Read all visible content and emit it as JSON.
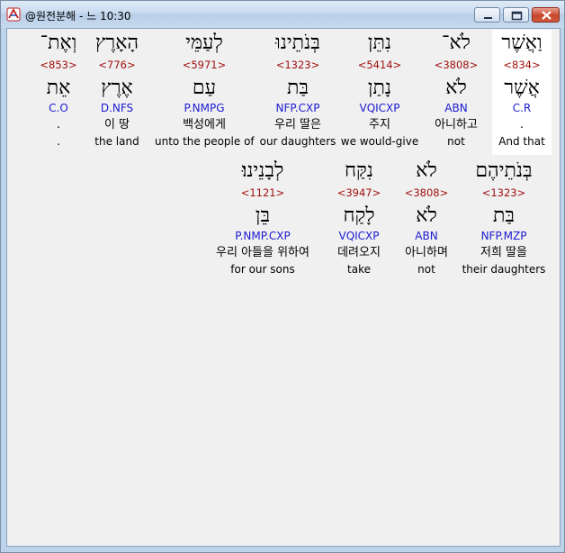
{
  "window": {
    "title": "@원전분해 - 느 10:30"
  },
  "rows": [
    [
      {
        "hebrew": "וַאֲשֶׁר",
        "strong": "<834>",
        "lemma": "אֲשֶׁר",
        "morph": "C.R",
        "korean": ".",
        "english": "And that"
      },
      {
        "hebrew": "לֹא־",
        "strong": "<3808>",
        "lemma": "לֹא",
        "morph": "ABN",
        "korean": "아니하고",
        "english": "not"
      },
      {
        "hebrew": "נִתֵּן",
        "strong": "<5414>",
        "lemma": "נָתַן",
        "morph": "VQICXP",
        "korean": "주지",
        "english": "we would-give"
      },
      {
        "hebrew": "בְּנֹתֵינוּ",
        "strong": "<1323>",
        "lemma": "בַּת",
        "morph": "NFP.CXP",
        "korean": "우리 딸은",
        "english": "our daughters"
      },
      {
        "hebrew": "לְעַמֵּי",
        "strong": "<5971>",
        "lemma": "עַם",
        "morph": "P.NMPG",
        "korean": "백성에게",
        "english": "unto the people of"
      },
      {
        "hebrew": "הָאָרֶץ",
        "strong": "<776>",
        "lemma": "אֶרֶץ",
        "morph": "D.NFS",
        "korean": "이 땅",
        "english": "the land"
      },
      {
        "hebrew": "וְאֶת־",
        "strong": "<853>",
        "lemma": "אֵת",
        "morph": "C.O",
        "korean": ".",
        "english": "."
      }
    ],
    [
      {
        "hebrew": "בְּנֹתֵיהֶם",
        "strong": "<1323>",
        "lemma": "בַּת",
        "morph": "NFP.MZP",
        "korean": "저희 딸을",
        "english": "their daughters"
      },
      {
        "hebrew": "לֹא",
        "strong": "<3808>",
        "lemma": "לֹא",
        "morph": "ABN",
        "korean": "아니하며",
        "english": "not"
      },
      {
        "hebrew": "נִקַּח",
        "strong": "<3947>",
        "lemma": "לָקַח",
        "morph": "VQICXP",
        "korean": "데려오지",
        "english": "take"
      },
      {
        "hebrew": "לְבָנֵינוּ׃",
        "strong": "<1121>",
        "lemma": "בֵּן",
        "morph": "P.NMP.CXP",
        "korean": "우리 아들을 위하여",
        "english": "for our sons"
      }
    ]
  ]
}
